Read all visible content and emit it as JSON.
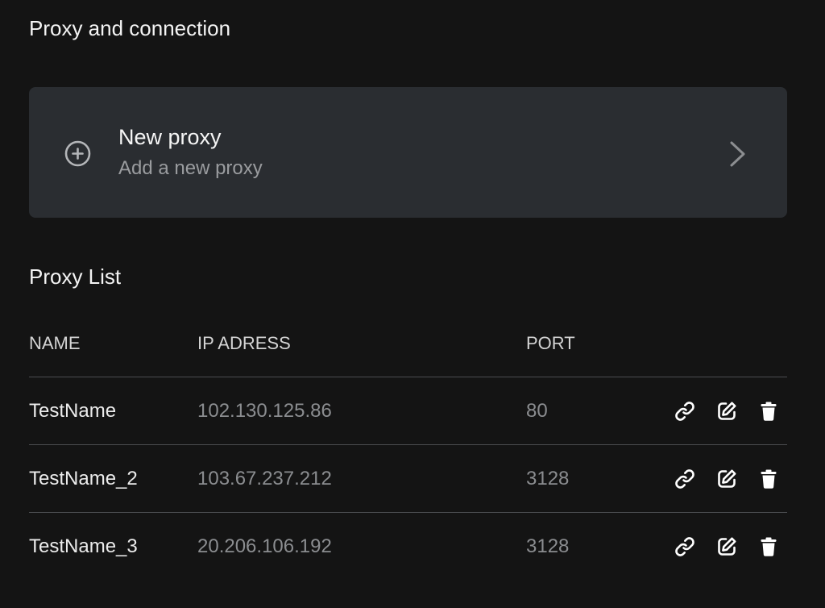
{
  "page": {
    "section_title": "Proxy and connection"
  },
  "new_proxy_card": {
    "icon": "plus-circle-icon",
    "title": "New proxy",
    "subtitle": "Add a new proxy",
    "chevron_icon": "chevron-right-icon"
  },
  "proxy_list": {
    "title": "Proxy List",
    "columns": {
      "name": "NAME",
      "ip": "IP ADRESS",
      "port": "PORT"
    },
    "rows": [
      {
        "name": "TestName",
        "ip": "102.130.125.86",
        "port": "80"
      },
      {
        "name": "TestName_2",
        "ip": "103.67.237.212",
        "port": "3128"
      },
      {
        "name": "TestName_3",
        "ip": "20.206.106.192",
        "port": "3128"
      }
    ],
    "row_action_icons": [
      "link-icon",
      "edit-icon",
      "trash-icon"
    ]
  },
  "colors": {
    "background": "#141414",
    "card_background": "#2a2d31",
    "divider": "#4b4d50",
    "primary_text": "#f4f4f4",
    "muted_text": "#8b8d90"
  }
}
